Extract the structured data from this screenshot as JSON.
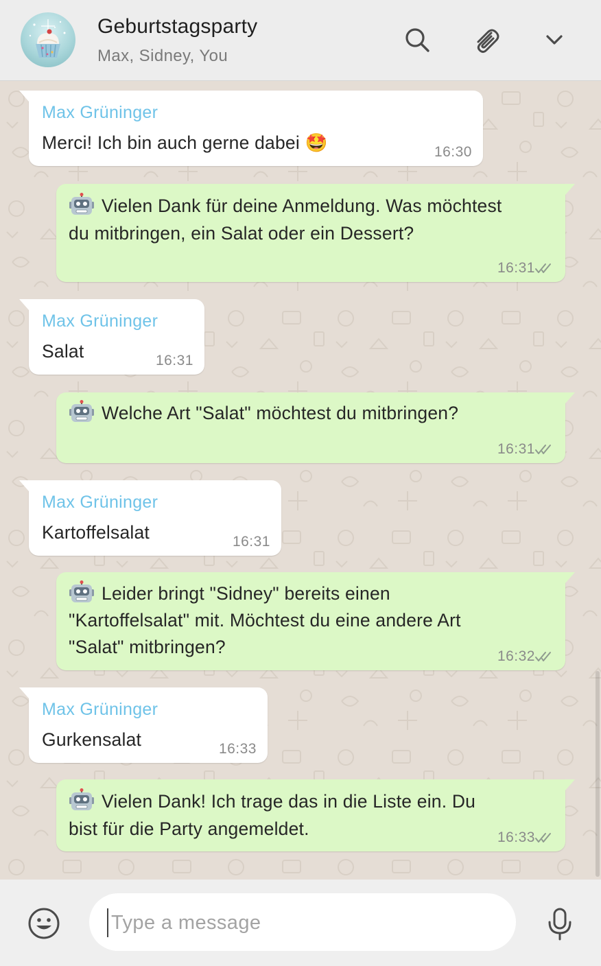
{
  "header": {
    "title": "Geburtstagsparty",
    "participants": "Max, Sidney, You"
  },
  "messages": [
    {
      "direction": "in",
      "sender": "Max Grüninger",
      "text": "Merci! Ich bin auch gerne dabei 🤩",
      "time": "16:30"
    },
    {
      "direction": "out",
      "icon": "robot-icon",
      "lines": [
        "Vielen Dank für deine Anmeldung. Was möchtest",
        "du mitbringen, ein Salat oder ein Dessert?"
      ],
      "time": "16:31",
      "status": "read"
    },
    {
      "direction": "in",
      "sender": "Max Grüninger",
      "text": "Salat",
      "time": "16:31"
    },
    {
      "direction": "out",
      "icon": "robot-icon",
      "lines": [
        "Welche Art \"Salat\" möchtest du mitbringen?"
      ],
      "time": "16:31",
      "status": "read"
    },
    {
      "direction": "in",
      "sender": "Max Grüninger",
      "text": "Kartoffelsalat",
      "time": "16:31"
    },
    {
      "direction": "out",
      "icon": "robot-icon",
      "lines": [
        "Leider bringt \"Sidney\" bereits einen",
        "\"Kartoffelsalat\" mit. Möchtest du eine andere Art",
        "\"Salat\" mitbringen?"
      ],
      "time": "16:32",
      "status": "read"
    },
    {
      "direction": "in",
      "sender": "Max Grüninger",
      "text": "Gurkensalat",
      "time": "16:33"
    },
    {
      "direction": "out",
      "icon": "robot-icon",
      "lines": [
        "Vielen Dank! Ich trage das in die Liste ein. Du",
        "bist für die Party angemeldet."
      ],
      "time": "16:33",
      "status": "read"
    }
  ],
  "composer": {
    "placeholder": "Type a message",
    "value": ""
  },
  "colors": {
    "incoming_bubble": "#ffffff",
    "outgoing_bubble": "#dcf8c6",
    "sender_name": "#6fc3e8",
    "chat_background": "#e5ddd5",
    "header_background": "#ededed"
  },
  "icons": [
    "search-icon",
    "paperclip-icon",
    "chevron-down-icon",
    "emoji-icon",
    "microphone-icon",
    "robot-icon",
    "double-check-icon"
  ]
}
